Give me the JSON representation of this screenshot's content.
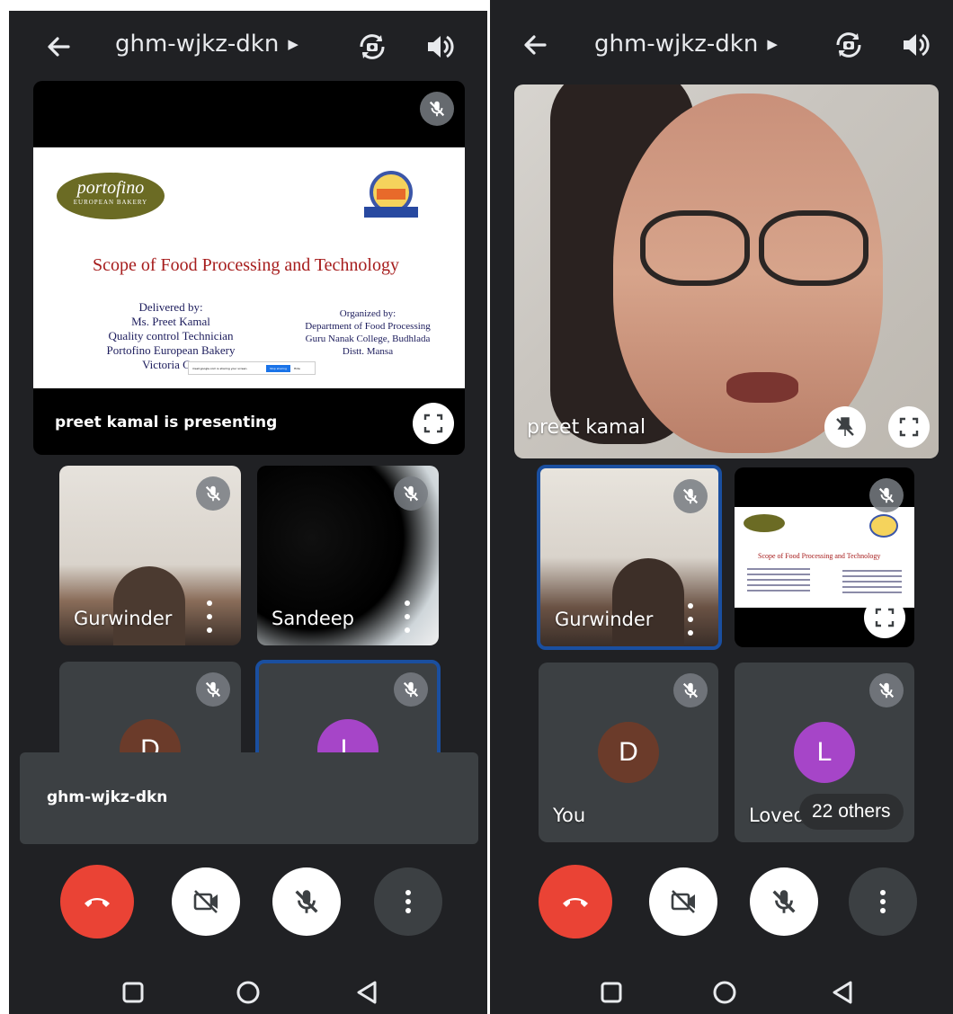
{
  "meeting": {
    "code": "ghm-wjkz-dkn"
  },
  "colors": {
    "background": "#202124",
    "tile": "#3c4043",
    "end_call": "#ea4335",
    "active_border": "#1a4fa0",
    "avatar_d": "#6b3b2a",
    "avatar_l": "#a645c8"
  },
  "left": {
    "presentation": {
      "status": "preet kamal is presenting",
      "slide": {
        "bakery_logo": "portofino",
        "bakery_logo_sub": "EUROPEAN BAKERY",
        "title": "Scope of Food Processing and Technology",
        "delivered_by": [
          "Delivered by:",
          "Ms. Preet Kamal",
          "Quality control Technician",
          "Portofino European Bakery",
          "Victoria Car"
        ],
        "organized_by": [
          "Organized by:",
          "Department of Food Processing",
          "Guru Nanak College, Budhlada",
          "Distt. Mansa"
        ],
        "share_notice": "meet.google.com is sharing your screen.",
        "stop_sharing": "Stop sharing",
        "hide": "Hide"
      }
    },
    "participants": [
      {
        "name": "Gurwinder"
      },
      {
        "name": "Sandeep"
      },
      {
        "avatar_letter": "D"
      },
      {
        "avatar_letter": "L"
      }
    ],
    "toast": "ghm-wjkz-dkn"
  },
  "right": {
    "main_speaker": {
      "name": "preet kamal"
    },
    "participants": [
      {
        "name": "Gurwinder"
      },
      {
        "slide_title": "Scope of Food Processing and Technology"
      },
      {
        "name": "You",
        "avatar_letter": "D"
      },
      {
        "name": "Loved",
        "avatar_letter": "L"
      }
    ],
    "others_chip": "22 others"
  },
  "icons": [
    "back-arrow-icon",
    "caret-right-icon",
    "camera-switch-icon",
    "speaker-icon",
    "mic-off-icon",
    "fullscreen-icon",
    "pin-off-icon",
    "end-call-icon",
    "camera-off-icon",
    "more-vert-icon",
    "square-icon",
    "circle-icon",
    "triangle-back-icon"
  ]
}
